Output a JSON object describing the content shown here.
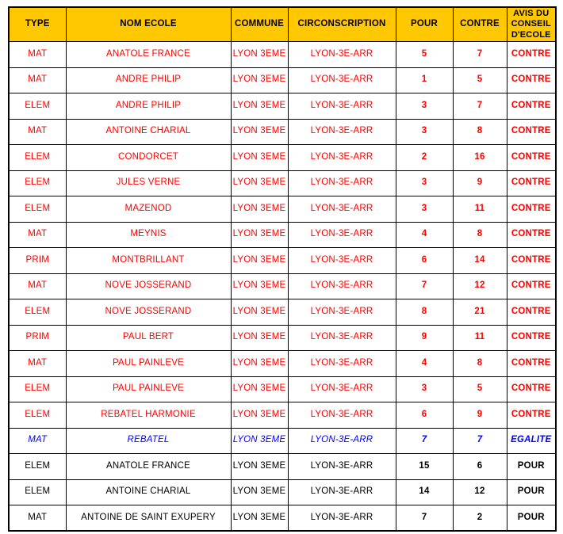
{
  "table": {
    "columns": [
      {
        "key": "type",
        "label": "TYPE"
      },
      {
        "key": "nom",
        "label": "NOM ECOLE"
      },
      {
        "key": "com",
        "label": "COMMUNE"
      },
      {
        "key": "circ",
        "label": "CIRCONSCRIPTION"
      },
      {
        "key": "pour",
        "label": "POUR"
      },
      {
        "key": "contre",
        "label": "CONTRE"
      },
      {
        "key": "avis",
        "label": "AVIS DU CONSEIL D'ECOLE"
      }
    ],
    "header_avis_lines": [
      "AVIS DU",
      "CONSEIL",
      "D'ECOLE"
    ],
    "colors": {
      "header_background": "#FFC800",
      "header_text": "#000000",
      "contre_text": "#FF0000",
      "egalite_text": "#0000FF",
      "pour_text": "#000000",
      "border": "#000000",
      "inner_border": "#808080",
      "cell_background": "#FFFFFF"
    },
    "rows": [
      {
        "type": "MAT",
        "nom": "ANATOLE FRANCE",
        "com": "LYON 3EME",
        "circ": "LYON-3E-ARR",
        "pour": "5",
        "contre": "7",
        "avis": "CONTRE",
        "outcome": "contre"
      },
      {
        "type": "MAT",
        "nom": "ANDRE PHILIP",
        "com": "LYON 3EME",
        "circ": "LYON-3E-ARR",
        "pour": "1",
        "contre": "5",
        "avis": "CONTRE",
        "outcome": "contre"
      },
      {
        "type": "ELEM",
        "nom": "ANDRE PHILIP",
        "com": "LYON 3EME",
        "circ": "LYON-3E-ARR",
        "pour": "3",
        "contre": "7",
        "avis": "CONTRE",
        "outcome": "contre"
      },
      {
        "type": "MAT",
        "nom": "ANTOINE CHARIAL",
        "com": "LYON 3EME",
        "circ": "LYON-3E-ARR",
        "pour": "3",
        "contre": "8",
        "avis": "CONTRE",
        "outcome": "contre"
      },
      {
        "type": "ELEM",
        "nom": "CONDORCET",
        "com": "LYON 3EME",
        "circ": "LYON-3E-ARR",
        "pour": "2",
        "contre": "16",
        "avis": "CONTRE",
        "outcome": "contre"
      },
      {
        "type": "ELEM",
        "nom": "JULES VERNE",
        "com": "LYON 3EME",
        "circ": "LYON-3E-ARR",
        "pour": "3",
        "contre": "9",
        "avis": "CONTRE",
        "outcome": "contre"
      },
      {
        "type": "ELEM",
        "nom": "MAZENOD",
        "com": "LYON 3EME",
        "circ": "LYON-3E-ARR",
        "pour": "3",
        "contre": "11",
        "avis": "CONTRE",
        "outcome": "contre"
      },
      {
        "type": "MAT",
        "nom": "MEYNIS",
        "com": "LYON 3EME",
        "circ": "LYON-3E-ARR",
        "pour": "4",
        "contre": "8",
        "avis": "CONTRE",
        "outcome": "contre"
      },
      {
        "type": "PRIM",
        "nom": "MONTBRILLANT",
        "com": "LYON 3EME",
        "circ": "LYON-3E-ARR",
        "pour": "6",
        "contre": "14",
        "avis": "CONTRE",
        "outcome": "contre"
      },
      {
        "type": "MAT",
        "nom": "NOVE JOSSERAND",
        "com": "LYON 3EME",
        "circ": "LYON-3E-ARR",
        "pour": "7",
        "contre": "12",
        "avis": "CONTRE",
        "outcome": "contre"
      },
      {
        "type": "ELEM",
        "nom": "NOVE JOSSERAND",
        "com": "LYON 3EME",
        "circ": "LYON-3E-ARR",
        "pour": "8",
        "contre": "21",
        "avis": "CONTRE",
        "outcome": "contre"
      },
      {
        "type": "PRIM",
        "nom": "PAUL BERT",
        "com": "LYON 3EME",
        "circ": "LYON-3E-ARR",
        "pour": "9",
        "contre": "11",
        "avis": "CONTRE",
        "outcome": "contre"
      },
      {
        "type": "MAT",
        "nom": "PAUL PAINLEVE",
        "com": "LYON 3EME",
        "circ": "LYON-3E-ARR",
        "pour": "4",
        "contre": "8",
        "avis": "CONTRE",
        "outcome": "contre"
      },
      {
        "type": "ELEM",
        "nom": "PAUL PAINLEVE",
        "com": "LYON 3EME",
        "circ": "LYON-3E-ARR",
        "pour": "3",
        "contre": "5",
        "avis": "CONTRE",
        "outcome": "contre"
      },
      {
        "type": "ELEM",
        "nom": "REBATEL HARMONIE",
        "com": "LYON 3EME",
        "circ": "LYON-3E-ARR",
        "pour": "6",
        "contre": "9",
        "avis": "CONTRE",
        "outcome": "contre"
      },
      {
        "type": "MAT",
        "nom": "REBATEL",
        "com": "LYON 3EME",
        "circ": "LYON-3E-ARR",
        "pour": "7",
        "contre": "7",
        "avis": "EGALITE",
        "outcome": "egalite"
      },
      {
        "type": "ELEM",
        "nom": "ANATOLE FRANCE",
        "com": "LYON 3EME",
        "circ": "LYON-3E-ARR",
        "pour": "15",
        "contre": "6",
        "avis": "POUR",
        "outcome": "pour"
      },
      {
        "type": "ELEM",
        "nom": "ANTOINE CHARIAL",
        "com": "LYON 3EME",
        "circ": "LYON-3E-ARR",
        "pour": "14",
        "contre": "12",
        "avis": "POUR",
        "outcome": "pour"
      },
      {
        "type": "MAT",
        "nom": "ANTOINE DE SAINT EXUPERY",
        "com": "LYON 3EME",
        "circ": "LYON-3E-ARR",
        "pour": "7",
        "contre": "2",
        "avis": "POUR",
        "outcome": "pour"
      }
    ]
  }
}
